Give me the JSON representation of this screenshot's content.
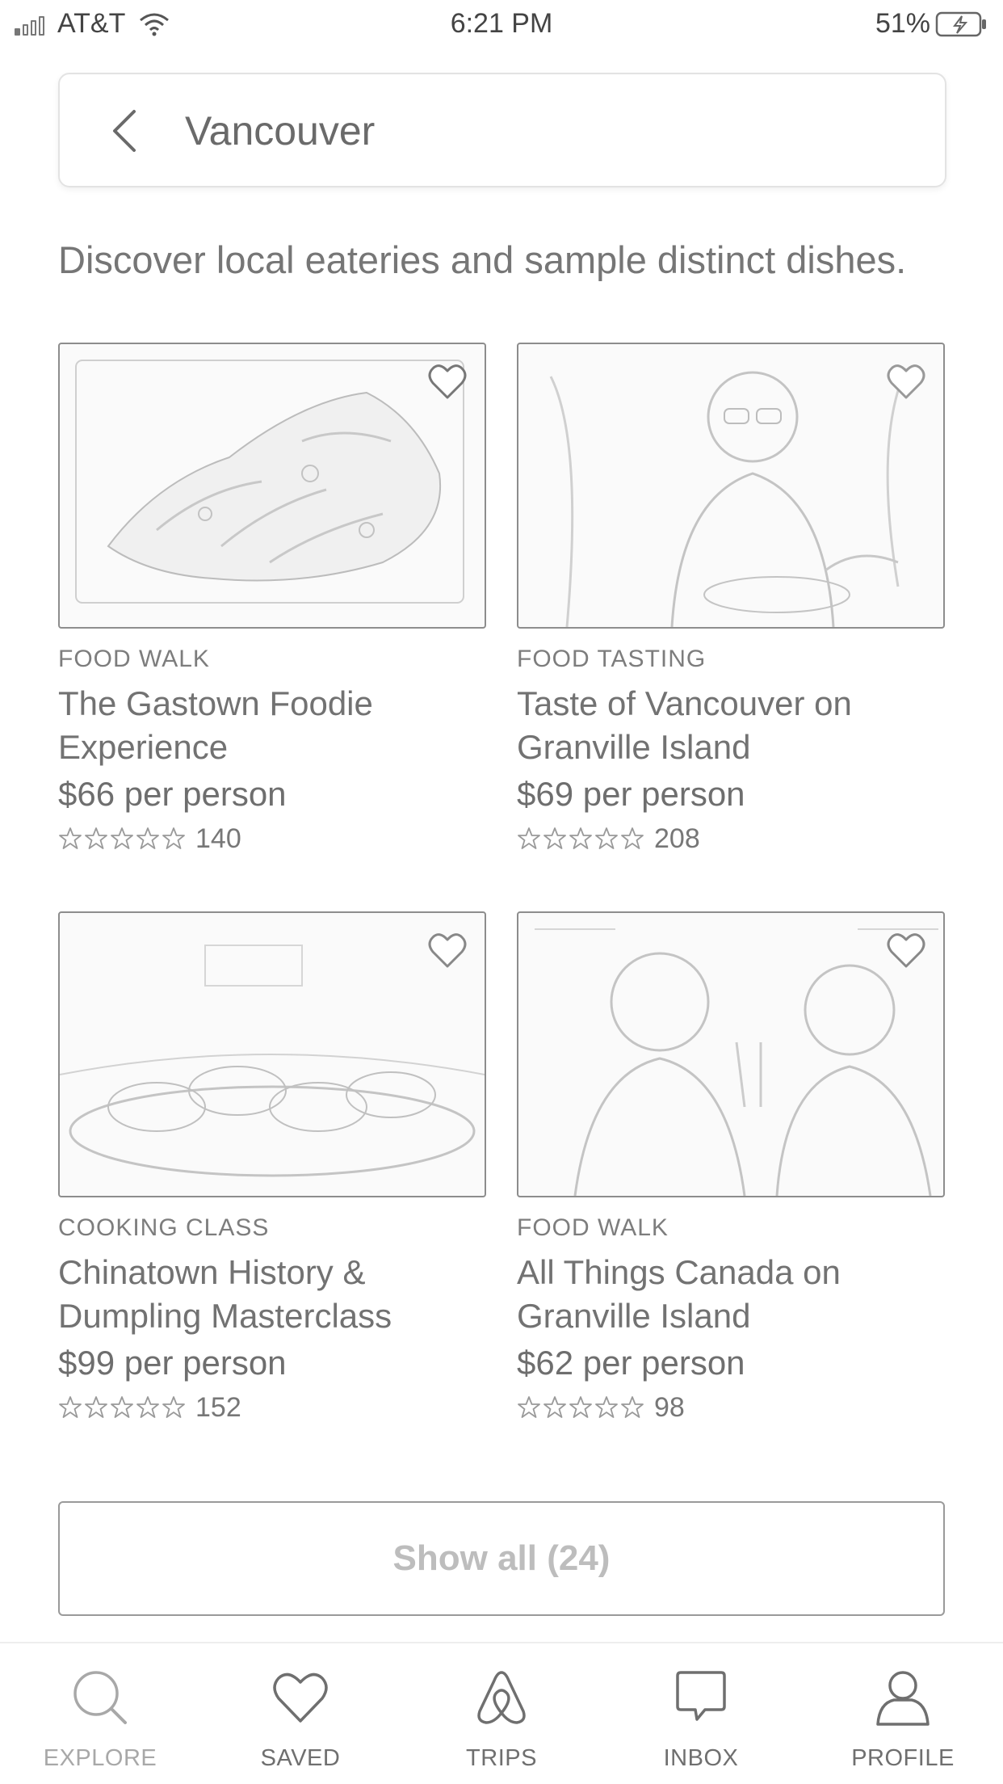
{
  "status_bar": {
    "carrier": "AT&T",
    "time": "6:21 PM",
    "battery": "51%"
  },
  "search": {
    "location": "Vancouver"
  },
  "subtitle": "Discover local eateries and sample distinct dishes.",
  "cards": [
    {
      "category": "FOOD WALK",
      "title": "The Gastown Foodie Experience",
      "price": "$66 per person",
      "reviews": "140",
      "rating_stars": 5
    },
    {
      "category": "FOOD TASTING",
      "title": "Taste of Vancouver on Granville Island",
      "price": "$69 per person",
      "reviews": "208",
      "rating_stars": 5
    },
    {
      "category": "COOKING CLASS",
      "title": "Chinatown History & Dumpling Masterclass",
      "price": "$99 per person",
      "reviews": "152",
      "rating_stars": 5
    },
    {
      "category": "FOOD WALK",
      "title": "All Things Canada on Granville Island",
      "price": "$62 per person",
      "reviews": "98",
      "rating_stars": 5
    }
  ],
  "show_all_label": "Show all (24)",
  "tabs": [
    {
      "label": "EXPLORE",
      "icon": "search-icon"
    },
    {
      "label": "SAVED",
      "icon": "heart-icon"
    },
    {
      "label": "TRIPS",
      "icon": "airbnb-logo-icon"
    },
    {
      "label": "INBOX",
      "icon": "message-icon"
    },
    {
      "label": "PROFILE",
      "icon": "person-icon"
    }
  ]
}
